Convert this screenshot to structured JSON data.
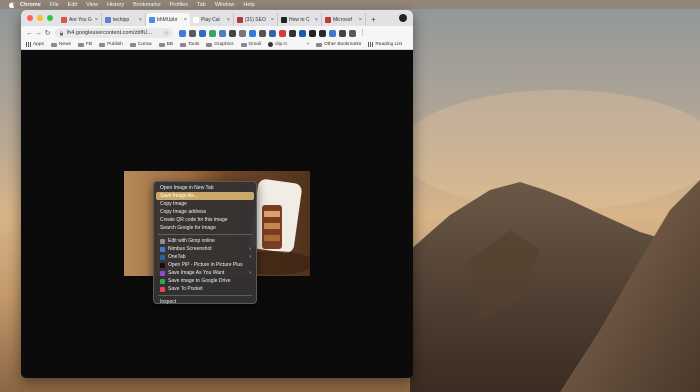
{
  "menubar": {
    "items": [
      "Chrome",
      "File",
      "Edit",
      "View",
      "History",
      "Bookmarks",
      "Profiles",
      "Tab",
      "Window",
      "Help"
    ]
  },
  "browser": {
    "tabs": [
      {
        "title": "Are You G",
        "color": "#d9534f"
      },
      {
        "title": "techipp",
        "color": "#5b7fd1"
      },
      {
        "title": "bhMUpbr",
        "color": "#4a8fe0"
      },
      {
        "title": "Play Cal",
        "color": "#ffffff"
      },
      {
        "title": "(31) SEO",
        "color": "#b03a2e"
      },
      {
        "title": "How to C",
        "color": "#222222"
      },
      {
        "title": "Microsof",
        "color": "#c0392b"
      }
    ],
    "active_tab_index": 2,
    "url": "lh4.googleusercontent.com/zbfIU...",
    "bookmarks": [
      "Apps",
      "News",
      "FB",
      "Publish",
      "Canva",
      "BB",
      "Tools",
      "Graphics",
      "Gmail",
      "clip.rc"
    ],
    "bookmarks_right": [
      "Other Bookmarks",
      "Reading List"
    ],
    "more_bookmarks": "»",
    "new_tab": "+"
  },
  "context_menu": {
    "group1": [
      "Open Image in New Tab",
      "Save Image As...",
      "Copy Image",
      "Copy Image address",
      "Create QR code for this image",
      "Search Google for Image"
    ],
    "highlighted": "Save Image As...",
    "group2": [
      {
        "label": "Edit with Gimp online",
        "icon_color": "#8f8f8f",
        "submenu": false
      },
      {
        "label": "Nimbus Screenshot",
        "icon_color": "#3b7dd8",
        "submenu": true
      },
      {
        "label": "OneTab",
        "icon_color": "#2c5fa8",
        "submenu": true
      },
      {
        "label": "Open PiP - Picture in Picture Plus",
        "icon_color": "#111111",
        "submenu": false
      },
      {
        "label": "Save Image As You Want",
        "icon_color": "#8a4fd1",
        "submenu": true
      },
      {
        "label": "Save image to Google Drive",
        "icon_color": "#34a853",
        "submenu": false
      },
      {
        "label": "Save To Pocket",
        "icon_color": "#ef4056",
        "submenu": false
      }
    ],
    "group3": [
      "Inspect"
    ]
  }
}
